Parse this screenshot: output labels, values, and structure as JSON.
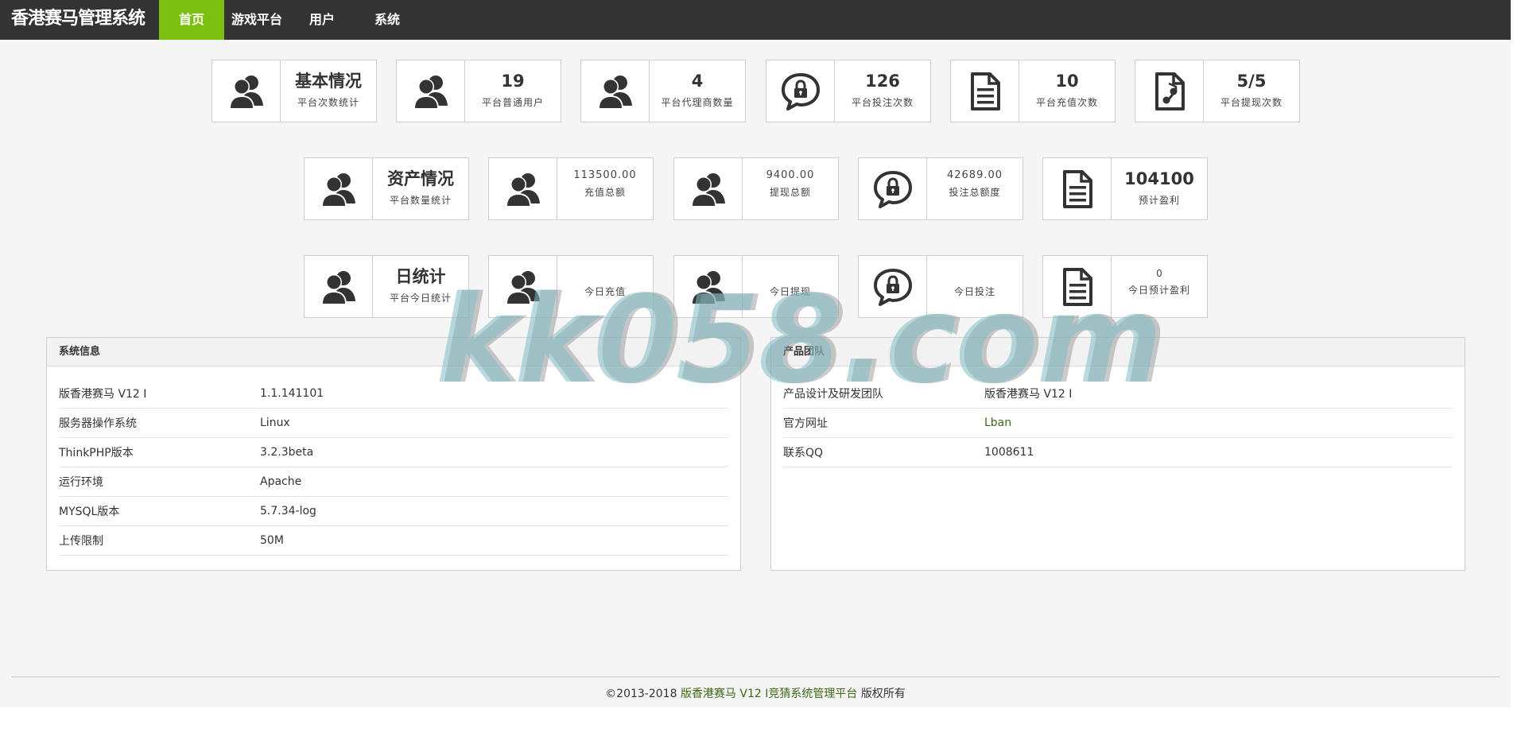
{
  "nav": {
    "brand": "香港赛马管理系统",
    "items": [
      {
        "label": "首页",
        "active": true
      },
      {
        "label": "游戏平台",
        "active": false
      },
      {
        "label": "用户",
        "active": false
      },
      {
        "label": "系统",
        "active": false
      }
    ],
    "active_color": "#7cc110",
    "bar_color": "#333333"
  },
  "row1": [
    {
      "icon": "users-icon",
      "value": "基本情况",
      "label": "平台次数统计"
    },
    {
      "icon": "users-icon",
      "value": "19",
      "label": "平台普通用户"
    },
    {
      "icon": "users-icon",
      "value": "4",
      "label": "平台代理商数量"
    },
    {
      "icon": "lock-chat-icon",
      "value": "126",
      "label": "平台投注次数"
    },
    {
      "icon": "document-icon",
      "value": "10",
      "label": "平台充值次数"
    },
    {
      "icon": "audio-file-icon",
      "value": "5/5",
      "label": "平台提现次数"
    }
  ],
  "row2": [
    {
      "icon": "users-icon",
      "value": "资产情况",
      "label": "平台数量统计"
    },
    {
      "icon": "users-icon",
      "value": "113500.00",
      "label": "充值总额"
    },
    {
      "icon": "users-icon",
      "value": "9400.00",
      "label": "提现总额"
    },
    {
      "icon": "lock-chat-icon",
      "value": "42689.00",
      "label": "投注总额度"
    },
    {
      "icon": "document-icon",
      "value": "104100",
      "label": "预计盈利"
    }
  ],
  "row3": [
    {
      "icon": "users-icon",
      "value": "日统计",
      "label": "平台今日统计"
    },
    {
      "icon": "users-icon",
      "value": "",
      "label": "今日充值"
    },
    {
      "icon": "users-icon",
      "value": "",
      "label": "今日提现"
    },
    {
      "icon": "lock-chat-icon",
      "value": "",
      "label": "今日投注"
    },
    {
      "icon": "document-icon",
      "value": "0",
      "label": "今日预计盈利"
    }
  ],
  "system_panel": {
    "title": "系统信息",
    "rows": [
      {
        "key": "版香港赛马 V12 I",
        "value": "1.1.141101"
      },
      {
        "key": "服务器操作系统",
        "value": "Linux"
      },
      {
        "key": "ThinkPHP版本",
        "value": "3.2.3beta"
      },
      {
        "key": "运行环境",
        "value": "Apache"
      },
      {
        "key": "MYSQL版本",
        "value": "5.7.34-log"
      },
      {
        "key": "上传限制",
        "value": "50M"
      }
    ]
  },
  "team_panel": {
    "title": "产品团队",
    "rows": [
      {
        "key": "产品设计及研发团队",
        "value": "版香港赛马 V12 I"
      },
      {
        "key": "官方网址",
        "value": "Lban"
      },
      {
        "key": "联系QQ",
        "value": "1008611"
      }
    ]
  },
  "footer": {
    "copyright": "©2013-2018",
    "link": "版香港赛马 V12 I竞猜系统管理平台",
    "suffix": "版权所有"
  },
  "watermark": "kk058.com"
}
